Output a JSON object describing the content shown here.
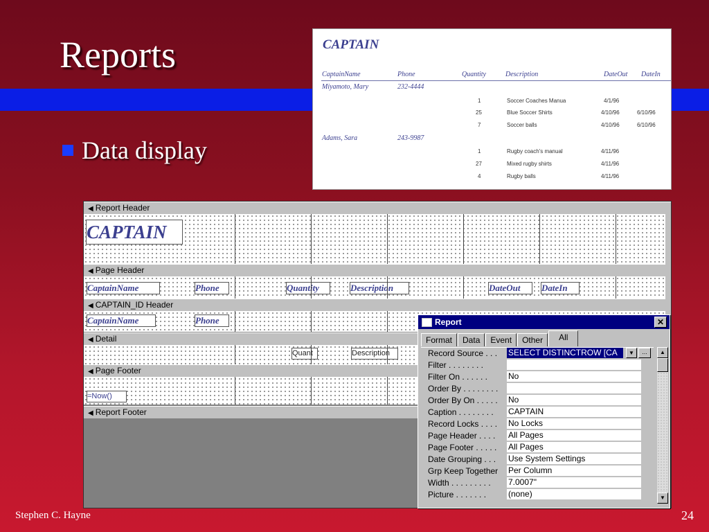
{
  "slide": {
    "title": "Reports",
    "bullet": "Data display",
    "author": "Stephen C. Hayne",
    "page": "24"
  },
  "preview": {
    "title": "CAPTAIN",
    "headers": [
      "CaptainName",
      "Phone",
      "Quantity",
      "Description",
      "DateOut",
      "DateIn"
    ],
    "groups": [
      {
        "name": "Miyamoto, Mary",
        "phone": "232-4444",
        "lines": [
          {
            "qty": "1",
            "desc": "Soccer Coaches Manua",
            "out": "4/1/96",
            "in": ""
          },
          {
            "qty": "25",
            "desc": "Blue Soccer Shirts",
            "out": "4/10/96",
            "in": "6/10/96"
          },
          {
            "qty": "7",
            "desc": "Soccer balls",
            "out": "4/10/96",
            "in": "6/10/96"
          }
        ]
      },
      {
        "name": "Adams, Sara",
        "phone": "243-9987",
        "lines": [
          {
            "qty": "1",
            "desc": "Rugby coach's manual",
            "out": "4/11/96",
            "in": ""
          },
          {
            "qty": "27",
            "desc": "Mixed rugby shirts",
            "out": "4/11/96",
            "in": ""
          },
          {
            "qty": "4",
            "desc": "Rugby balls",
            "out": "4/11/96",
            "in": ""
          }
        ]
      }
    ]
  },
  "design": {
    "bands": {
      "report_header": "Report Header",
      "page_header": "Page Header",
      "group_header": "CAPTAIN_ID Header",
      "detail": "Detail",
      "page_footer": "Page Footer",
      "report_footer": "Report Footer"
    },
    "controls": {
      "report_title": "CAPTAIN",
      "ph_captain": "CaptainName",
      "ph_phone": "Phone",
      "ph_quantity": "Quantity",
      "ph_description": "Description",
      "ph_dateout": "DateOut",
      "ph_datein": "DateIn",
      "gh_captain": "CaptainName",
      "gh_phone": "Phone",
      "det_quantity": "Quant",
      "det_description": "Description",
      "pf_now": "=Now()"
    }
  },
  "properties": {
    "title": "Report",
    "tabs": [
      "Format",
      "Data",
      "Event",
      "Other",
      "All"
    ],
    "active_tab": "All",
    "rows": [
      {
        "label": "Record Source . . .",
        "value": "SELECT DISTINCTROW [CA"
      },
      {
        "label": "Filter . . .  . . . . .",
        "value": ""
      },
      {
        "label": "Filter On . .  . . . .",
        "value": "No"
      },
      {
        "label": "Order By . . . .  . . . .",
        "value": ""
      },
      {
        "label": "Order By On . .  . . .",
        "value": "No"
      },
      {
        "label": "Caption . . . .  . . . .",
        "value": "CAPTAIN"
      },
      {
        "label": "Record Locks . . . .",
        "value": "No Locks"
      },
      {
        "label": "Page Header . .  . .",
        "value": "All Pages"
      },
      {
        "label": "Page Footer . . .  . .",
        "value": "All Pages"
      },
      {
        "label": "Date Grouping . .  .",
        "value": "Use System Settings"
      },
      {
        "label": "Grp Keep Together",
        "value": "Per Column"
      },
      {
        "label": "Width . . .  . . . . . .",
        "value": "7.0007\""
      },
      {
        "label": "Picture . .  . . . . .",
        "value": "(none)"
      }
    ],
    "scroll_up": "▲",
    "scroll_down": "▼",
    "dropdown_glyph": "▼",
    "builder_glyph": "...",
    "close_glyph": "✕"
  },
  "icons": {
    "band_arrow": "◀",
    "bullet": "square"
  }
}
